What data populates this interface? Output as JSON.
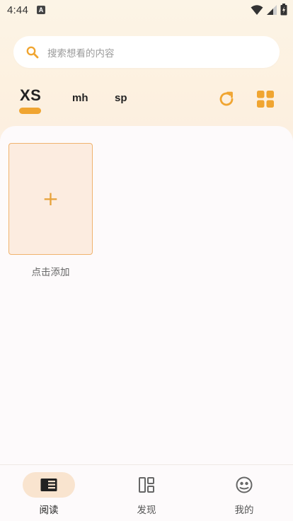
{
  "status_bar": {
    "time": "4:44",
    "notification_letter": "A"
  },
  "search": {
    "placeholder": "搜索想看的内容"
  },
  "tabs": [
    {
      "label": "XS",
      "active": true
    },
    {
      "label": "mh",
      "active": false
    },
    {
      "label": "sp",
      "active": false
    }
  ],
  "toolbar": {
    "refresh_icon": "refresh-icon",
    "layout_icon": "grid-icon"
  },
  "shelf": {
    "add_symbol": "+",
    "add_label": "点击添加"
  },
  "bottom_nav": [
    {
      "label": "阅读",
      "icon": "book-icon",
      "active": true
    },
    {
      "label": "发现",
      "icon": "dashboard-icon",
      "active": false
    },
    {
      "label": "我的",
      "icon": "profile-icon",
      "active": false
    }
  ],
  "colors": {
    "accent": "#f0a531",
    "pill": "#f9e4cf",
    "tile_bg": "#fcece0"
  }
}
